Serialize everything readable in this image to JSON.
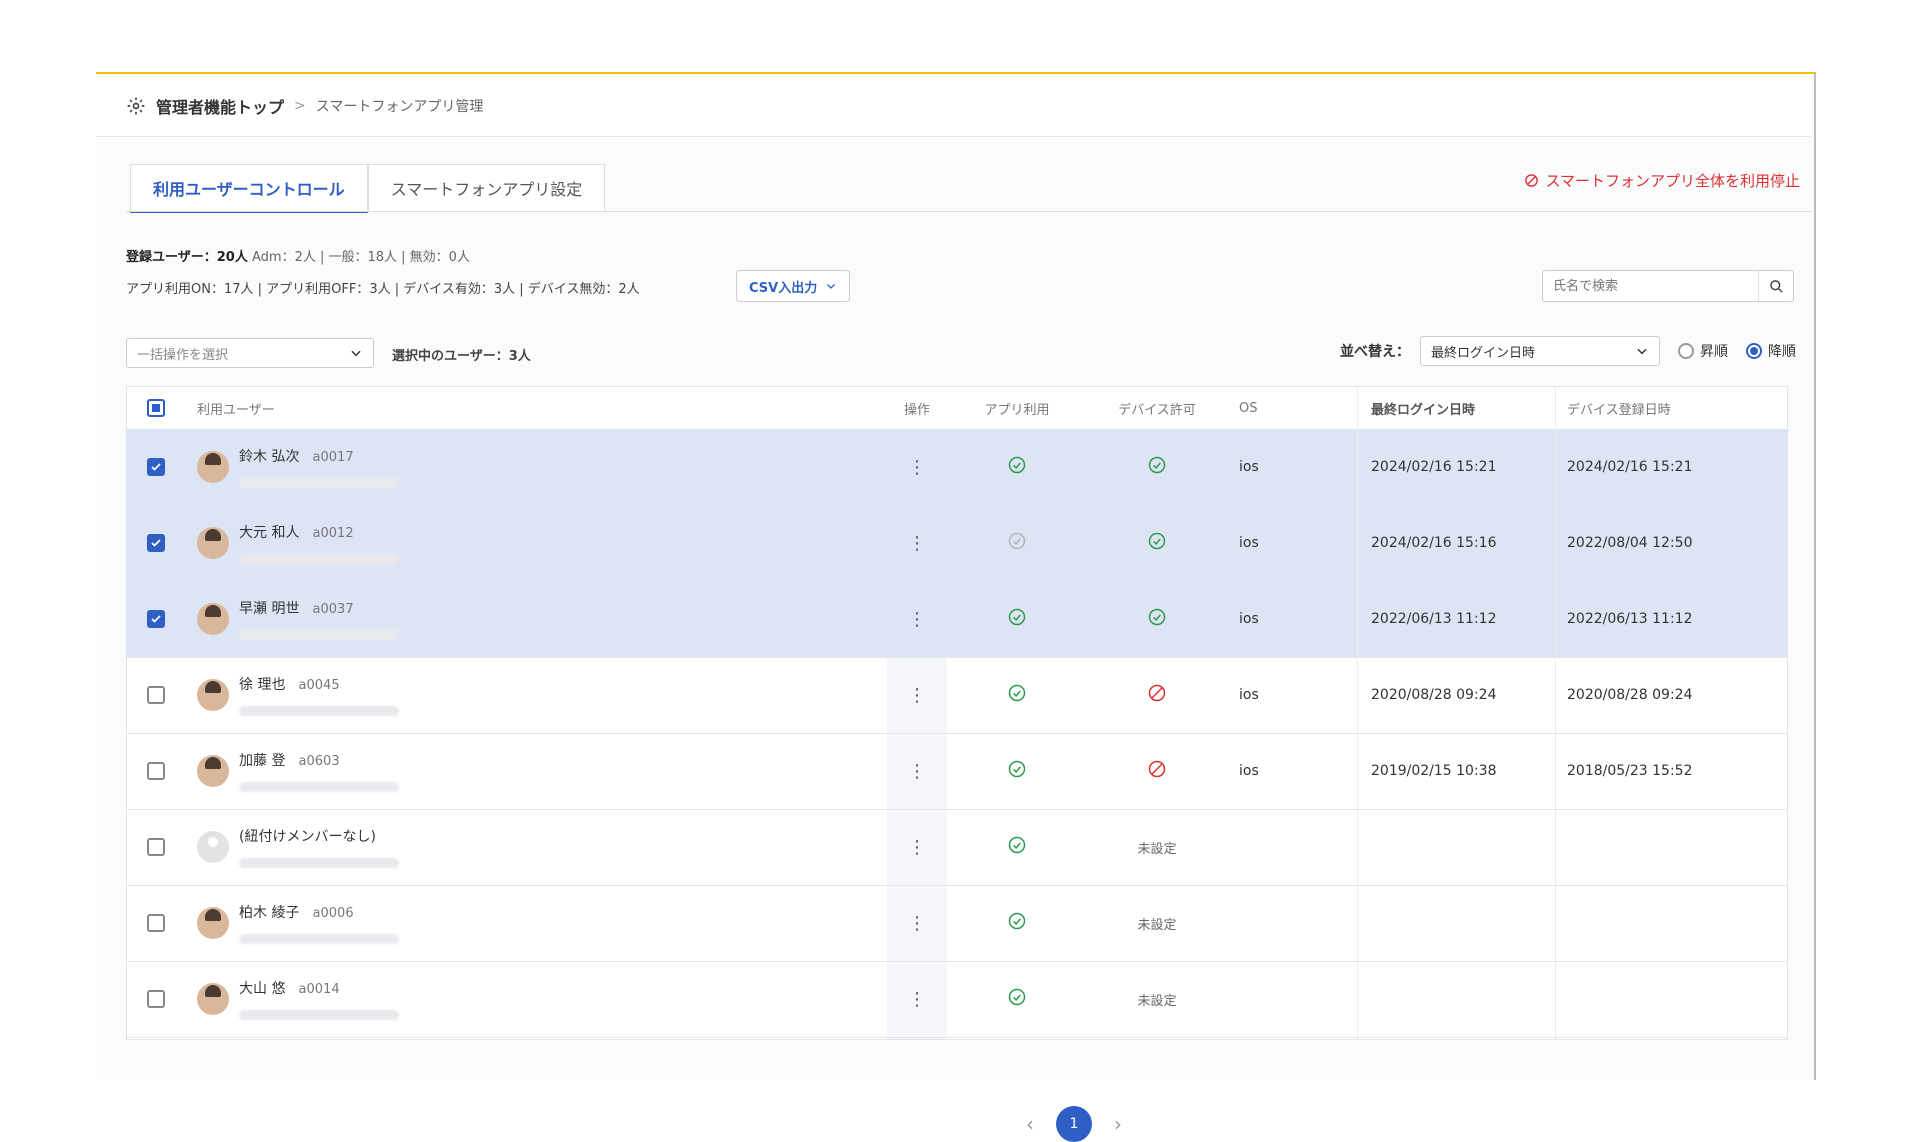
{
  "breadcrumb": {
    "top": "管理者機能トップ",
    "separator": ">",
    "current": "スマートフォンアプリ管理"
  },
  "tabs": [
    {
      "label": "利用ユーザーコントロール"
    },
    {
      "label": "スマートフォンアプリ設定"
    }
  ],
  "stop_link": "スマートフォンアプリ全体を利用停止",
  "stats": {
    "registered_label": "登録ユーザー：20人",
    "registered_detail": "Adm：2人 | 一般：18人 | 無効：0人",
    "app_device": "アプリ利用ON：17人 | アプリ利用OFF：3人 | デバイス有効：3人 | デバイス無効：2人"
  },
  "csv_button": "CSV入出力",
  "search": {
    "placeholder": "氏名で検索"
  },
  "bulk": {
    "placeholder": "一括操作を選択",
    "selected_info": "選択中のユーザー：3人"
  },
  "sort": {
    "label": "並べ替え：",
    "value": "最終ログイン日時",
    "asc": "昇順",
    "desc": "降順"
  },
  "columns": {
    "user": "利用ユーザー",
    "action": "操作",
    "app": "アプリ利用",
    "device": "デバイス許可",
    "os": "OS",
    "last_login": "最終ログイン日時",
    "device_reg": "デバイス登録日時"
  },
  "rows": [
    {
      "name": "鈴木 弘次",
      "id": "a0017",
      "app": "on",
      "device": "ok",
      "device_text": "",
      "os": "ios",
      "last_login": "2024/02/16 15:21",
      "device_reg": "2024/02/16 15:21"
    },
    {
      "name": "大元 和人",
      "id": "a0012",
      "app": "off",
      "device": "ok",
      "device_text": "",
      "os": "ios",
      "last_login": "2024/02/16 15:16",
      "device_reg": "2022/08/04 12:50"
    },
    {
      "name": "早瀬 明世",
      "id": "a0037",
      "app": "on",
      "device": "ok",
      "device_text": "",
      "os": "ios",
      "last_login": "2022/06/13 11:12",
      "device_reg": "2022/06/13 11:12"
    },
    {
      "name": "徐 理也",
      "id": "a0045",
      "app": "on",
      "device": "ng",
      "device_text": "",
      "os": "ios",
      "last_login": "2020/08/28 09:24",
      "device_reg": "2020/08/28 09:24"
    },
    {
      "name": "加藤 登",
      "id": "a0603",
      "app": "on",
      "device": "ng",
      "device_text": "",
      "os": "ios",
      "last_login": "2019/02/15 10:38",
      "device_reg": "2018/05/23 15:52"
    },
    {
      "name": "(紐付けメンバーなし)",
      "id": "",
      "app": "on",
      "device": "none",
      "device_text": "未設定",
      "os": "",
      "last_login": "",
      "device_reg": ""
    },
    {
      "name": "柏木 綾子",
      "id": "a0006",
      "app": "on",
      "device": "none",
      "device_text": "未設定",
      "os": "",
      "last_login": "",
      "device_reg": ""
    },
    {
      "name": "大山 悠",
      "id": "a0014",
      "app": "on",
      "device": "none",
      "device_text": "未設定",
      "os": "",
      "last_login": "",
      "device_reg": ""
    }
  ],
  "pagination": {
    "current": "1"
  }
}
